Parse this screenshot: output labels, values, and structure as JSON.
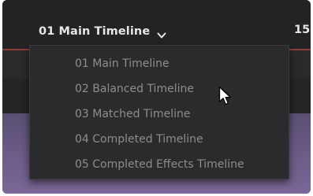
{
  "header": {
    "selected_timeline": "01 Main Timeline",
    "timecode_partial": "15:"
  },
  "timeline_menu": {
    "items": [
      {
        "label": "01 Main Timeline"
      },
      {
        "label": "02 Balanced Timeline"
      },
      {
        "label": "03 Matched Timeline"
      },
      {
        "label": "04 Completed Timeline"
      },
      {
        "label": "05 Completed Effects Timeline"
      }
    ]
  },
  "icons": {
    "dropdown_chevron": "chevron-down-icon",
    "pointer": "mouse-pointer-icon"
  },
  "colors": {
    "accent_line": "#a8322b",
    "menu_background": "#2b2b2d",
    "menu_text": "#8d8d90",
    "header_text": "#e6e6e6"
  }
}
